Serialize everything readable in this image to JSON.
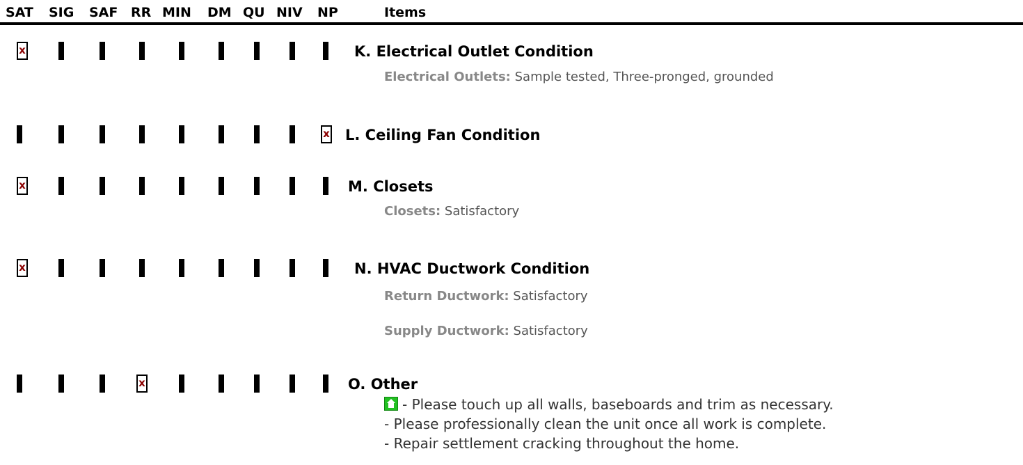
{
  "columns": [
    "SAT",
    "SIG",
    "SAF",
    "RR",
    "MIN",
    "DM",
    "QU",
    "NIV",
    "NP"
  ],
  "items_header": "Items",
  "check_mark": "x",
  "rows": [
    {
      "letter": "K.",
      "title": "Electrical Outlet Condition",
      "checked": "SAT",
      "details": [
        {
          "label": "Electrical Outlets:",
          "value": "Sample tested, Three-pronged, grounded"
        }
      ]
    },
    {
      "letter": "L.",
      "title": "Ceiling Fan Condition",
      "checked": "NP",
      "details": []
    },
    {
      "letter": "M.",
      "title": "Closets",
      "checked": "SAT",
      "details": [
        {
          "label": "Closets:",
          "value": "Satisfactory"
        }
      ]
    },
    {
      "letter": "N.",
      "title": "HVAC Ductwork Condition",
      "checked": "SAT",
      "details": [
        {
          "label": "Return Ductwork:",
          "value": "Satisfactory"
        },
        {
          "label": "Supply Ductwork:",
          "value": "Satisfactory"
        }
      ]
    },
    {
      "letter": "O.",
      "title": "Other",
      "checked": "RR",
      "notes": [
        "- Please touch up all walls, baseboards and trim as necessary.",
        "- Please professionally clean the unit once all work is complete.",
        "- Repair settlement cracking throughout the home."
      ]
    }
  ],
  "icons": {
    "note_icon": "home-icon",
    "note_icon_color": "#22c022",
    "check_color": "#8b0000"
  }
}
